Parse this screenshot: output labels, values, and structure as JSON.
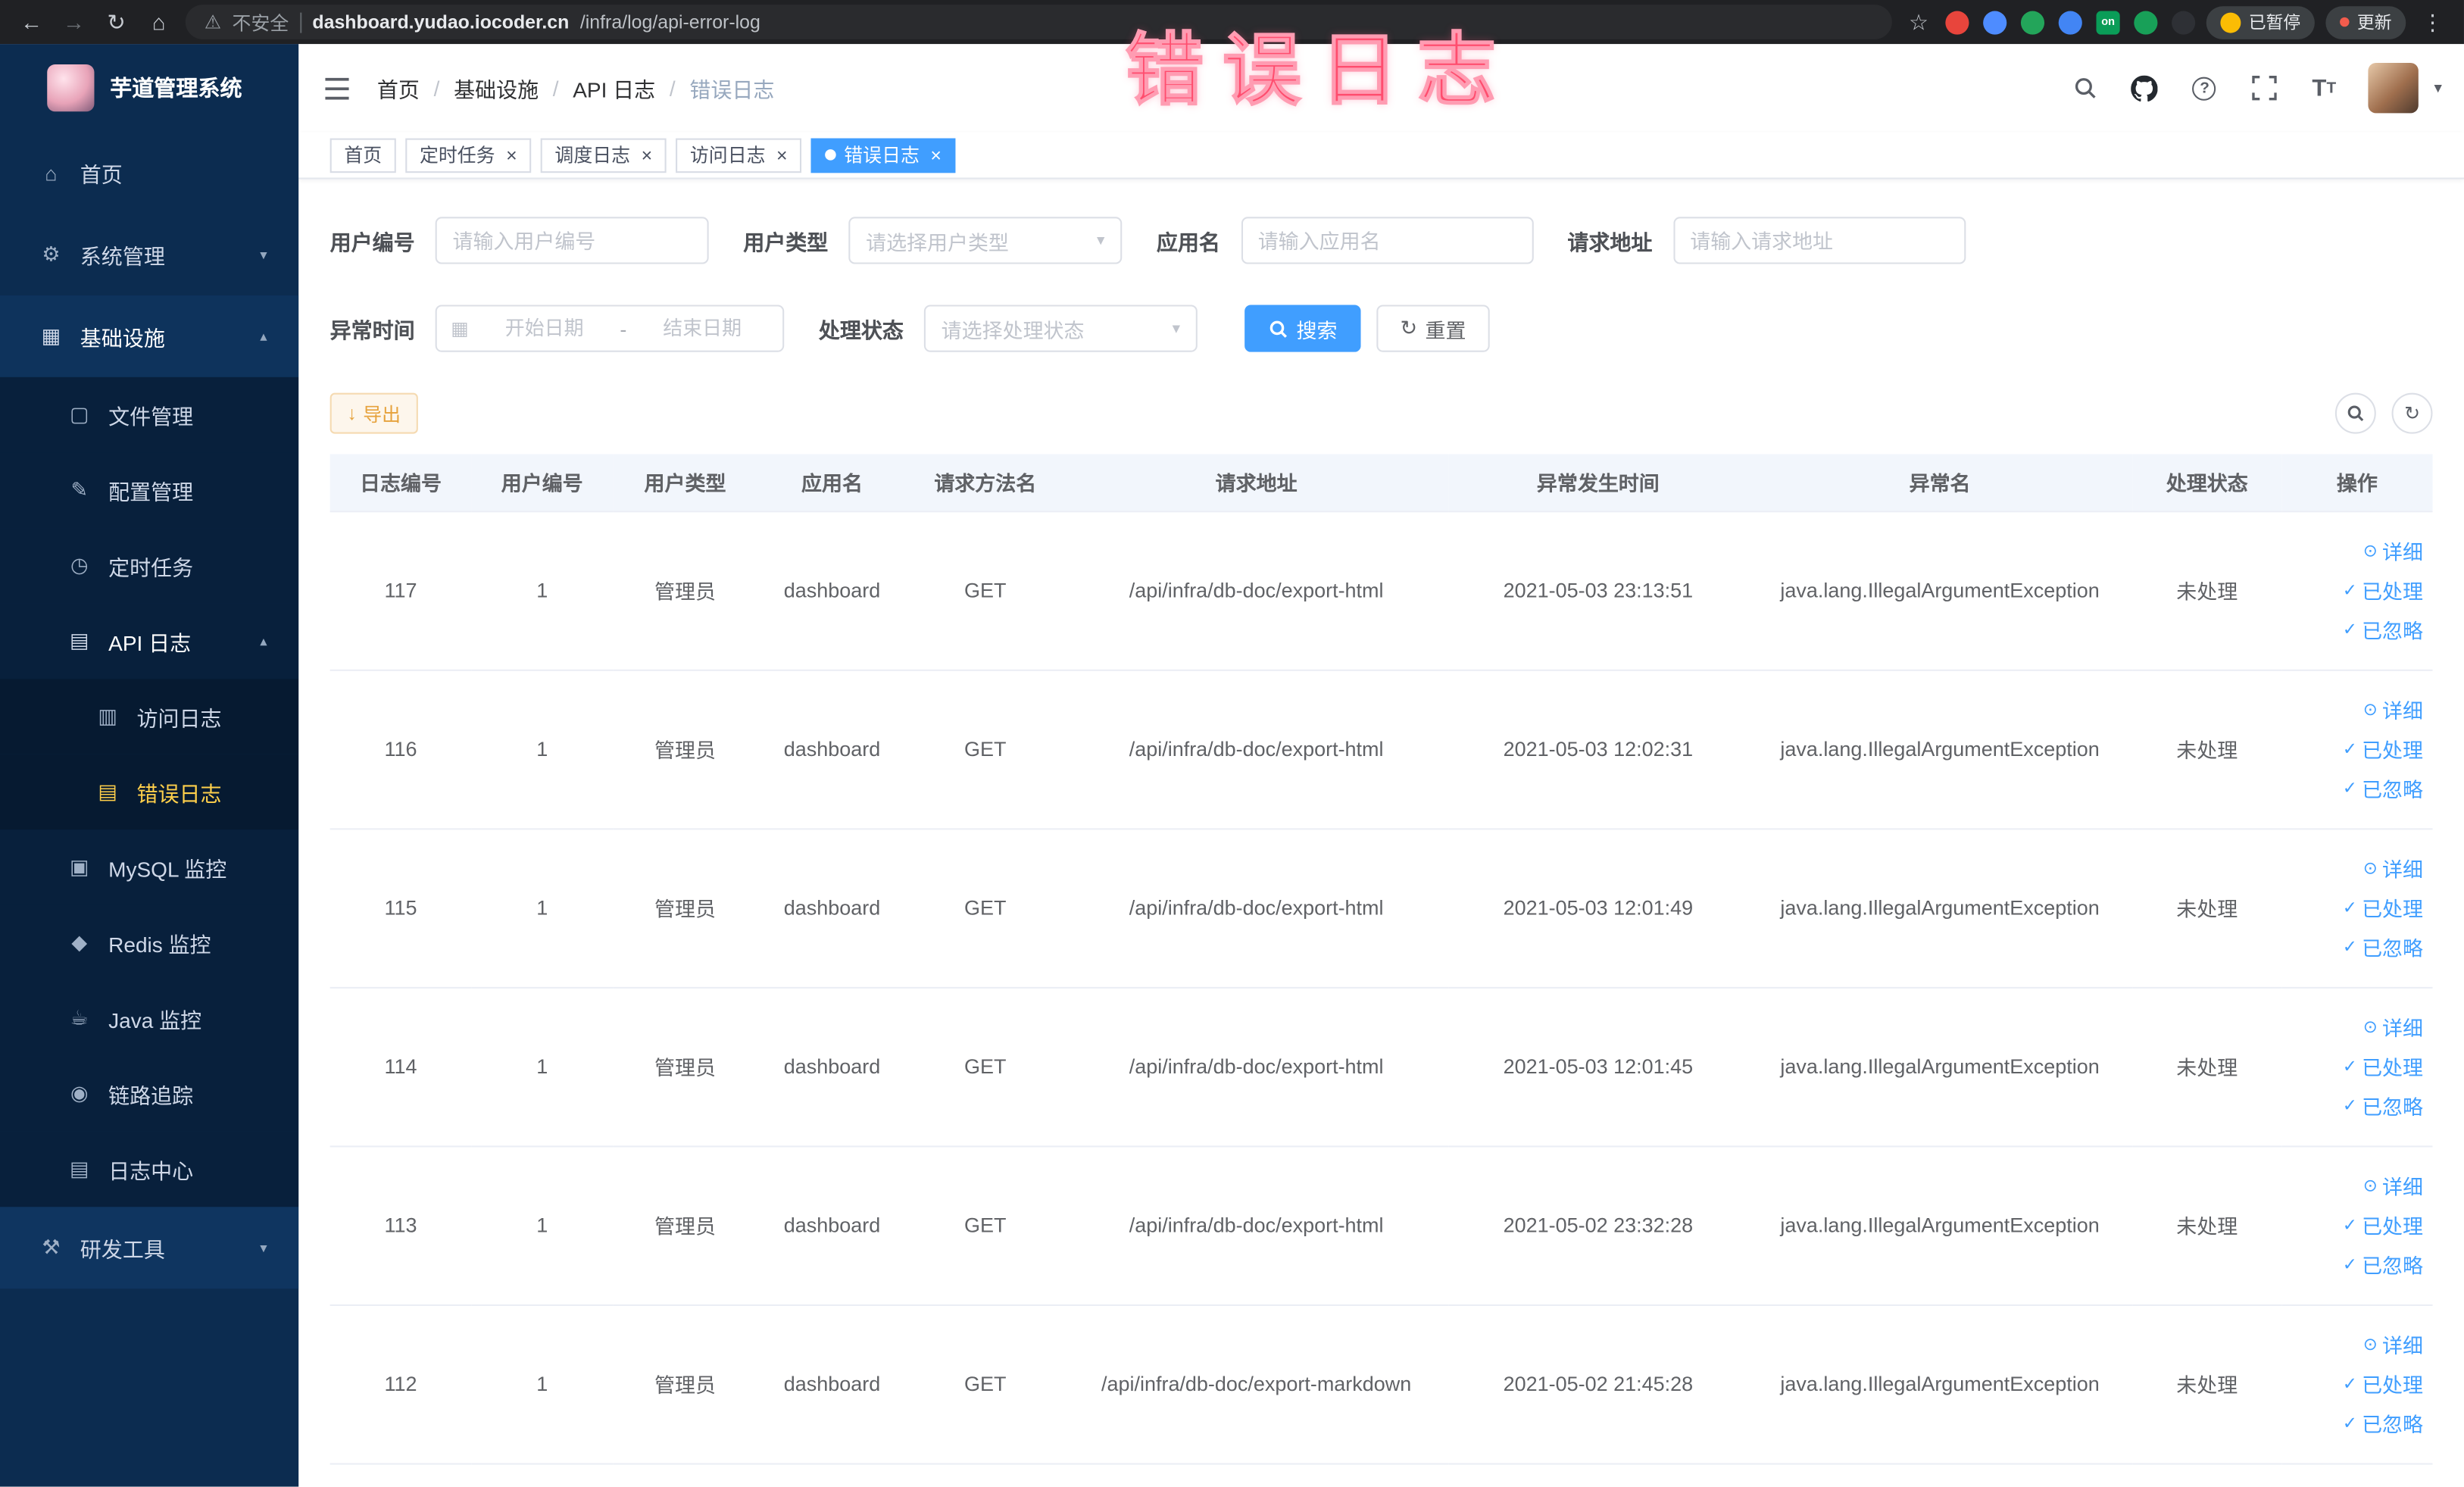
{
  "browser": {
    "security_label": "不安全",
    "url_domain": "dashboard.yudao.iocoder.cn",
    "url_path": "/infra/log/api-error-log",
    "paused_label": "已暂停",
    "update_label": "更新",
    "extensions": [
      {
        "color": "#e8453c"
      },
      {
        "color": "#4e8cff"
      },
      {
        "color": "#23a55a"
      },
      {
        "color": "#4285f4"
      },
      {
        "color": "#0a9d58",
        "label": "on"
      },
      {
        "color": "#18a058"
      },
      {
        "color": "#2e3035"
      }
    ]
  },
  "annotation": {
    "text": "错误日志",
    "color": "#ff4d6e"
  },
  "sidebar": {
    "title": "芋道管理系统",
    "items": [
      {
        "key": "home",
        "label": "首页",
        "icon": "home",
        "level": 1
      },
      {
        "key": "system-management",
        "label": "系统管理",
        "icon": "gear",
        "level": 1,
        "expandable": true,
        "expanded": false
      },
      {
        "key": "infrastructure",
        "label": "基础设施",
        "icon": "infrastructure",
        "level": 1,
        "expandable": true,
        "expanded": true
      },
      {
        "key": "file-management",
        "label": "文件管理",
        "icon": "file",
        "level": 2
      },
      {
        "key": "config-management",
        "label": "配置管理",
        "icon": "config",
        "level": 2
      },
      {
        "key": "scheduled-task",
        "label": "定时任务",
        "icon": "timer",
        "level": 2
      },
      {
        "key": "api-log",
        "label": "API 日志",
        "icon": "api-log",
        "level": 2,
        "expandable": true,
        "expanded": true
      },
      {
        "key": "access-log",
        "label": "访问日志",
        "icon": "access-log",
        "level": 3
      },
      {
        "key": "error-log",
        "label": "错误日志",
        "icon": "error-log",
        "level": 3,
        "active": true
      },
      {
        "key": "mysql-monitor",
        "label": "MySQL 监控",
        "icon": "mysql",
        "level": 2
      },
      {
        "key": "redis-monitor",
        "label": "Redis 监控",
        "icon": "redis",
        "level": 2
      },
      {
        "key": "java-monitor",
        "label": "Java 监控",
        "icon": "java",
        "level": 2
      },
      {
        "key": "trace",
        "label": "链路追踪",
        "icon": "trace",
        "level": 2
      },
      {
        "key": "log-center",
        "label": "日志中心",
        "icon": "log-center",
        "level": 2
      },
      {
        "key": "dev-tools",
        "label": "研发工具",
        "icon": "tools",
        "level": 1,
        "expandable": true,
        "expanded": false
      }
    ]
  },
  "header": {
    "breadcrumb": [
      "首页",
      "基础设施",
      "API 日志",
      "错误日志"
    ]
  },
  "tabs": [
    {
      "key": "home",
      "label": "首页",
      "closable": false,
      "active": false
    },
    {
      "key": "scheduled-task",
      "label": "定时任务",
      "closable": true,
      "active": false
    },
    {
      "key": "job-log",
      "label": "调度日志",
      "closable": true,
      "active": false
    },
    {
      "key": "access-log",
      "label": "访问日志",
      "closable": true,
      "active": false
    },
    {
      "key": "error-log",
      "label": "错误日志",
      "closable": true,
      "active": true
    }
  ],
  "filters": {
    "user_id": {
      "label": "用户编号",
      "placeholder": "请输入用户编号",
      "value": ""
    },
    "user_type": {
      "label": "用户类型",
      "placeholder": "请选择用户类型",
      "value": ""
    },
    "app_name": {
      "label": "应用名",
      "placeholder": "请输入应用名",
      "value": ""
    },
    "request_url": {
      "label": "请求地址",
      "placeholder": "请输入请求地址",
      "value": ""
    },
    "exception_time": {
      "label": "异常时间",
      "start_placeholder": "开始日期",
      "separator": "-",
      "end_placeholder": "结束日期"
    },
    "process_status": {
      "label": "处理状态",
      "placeholder": "请选择处理状态",
      "value": ""
    },
    "search_label": "搜索",
    "reset_label": "重置"
  },
  "toolbar": {
    "export_label": "导出"
  },
  "table": {
    "columns": [
      "日志编号",
      "用户编号",
      "用户类型",
      "应用名",
      "请求方法名",
      "请求地址",
      "异常发生时间",
      "异常名",
      "处理状态",
      "操作"
    ],
    "row_actions": [
      "详细",
      "已处理",
      "已忽略"
    ],
    "rows": [
      {
        "id": "117",
        "user_id": "1",
        "user_type": "管理员",
        "app_name": "dashboard",
        "method": "GET",
        "url": "/api/infra/db-doc/export-html",
        "time": "2021-05-03 23:13:51",
        "exception": "java.lang.IllegalArgumentException",
        "status": "未处理"
      },
      {
        "id": "116",
        "user_id": "1",
        "user_type": "管理员",
        "app_name": "dashboard",
        "method": "GET",
        "url": "/api/infra/db-doc/export-html",
        "time": "2021-05-03 12:02:31",
        "exception": "java.lang.IllegalArgumentException",
        "status": "未处理"
      },
      {
        "id": "115",
        "user_id": "1",
        "user_type": "管理员",
        "app_name": "dashboard",
        "method": "GET",
        "url": "/api/infra/db-doc/export-html",
        "time": "2021-05-03 12:01:49",
        "exception": "java.lang.IllegalArgumentException",
        "status": "未处理"
      },
      {
        "id": "114",
        "user_id": "1",
        "user_type": "管理员",
        "app_name": "dashboard",
        "method": "GET",
        "url": "/api/infra/db-doc/export-html",
        "time": "2021-05-03 12:01:45",
        "exception": "java.lang.IllegalArgumentException",
        "status": "未处理"
      },
      {
        "id": "113",
        "user_id": "1",
        "user_type": "管理员",
        "app_name": "dashboard",
        "method": "GET",
        "url": "/api/infra/db-doc/export-html",
        "time": "2021-05-02 23:32:28",
        "exception": "java.lang.IllegalArgumentException",
        "status": "未处理"
      },
      {
        "id": "112",
        "user_id": "1",
        "user_type": "管理员",
        "app_name": "dashboard",
        "method": "GET",
        "url": "/api/infra/db-doc/export-markdown",
        "time": "2021-05-02 21:45:28",
        "exception": "java.lang.IllegalArgumentException",
        "status": "未处理"
      }
    ]
  },
  "colors": {
    "primary": "#409eff",
    "warning": "#e6a23c",
    "sidebar_active": "#ffd04b"
  }
}
